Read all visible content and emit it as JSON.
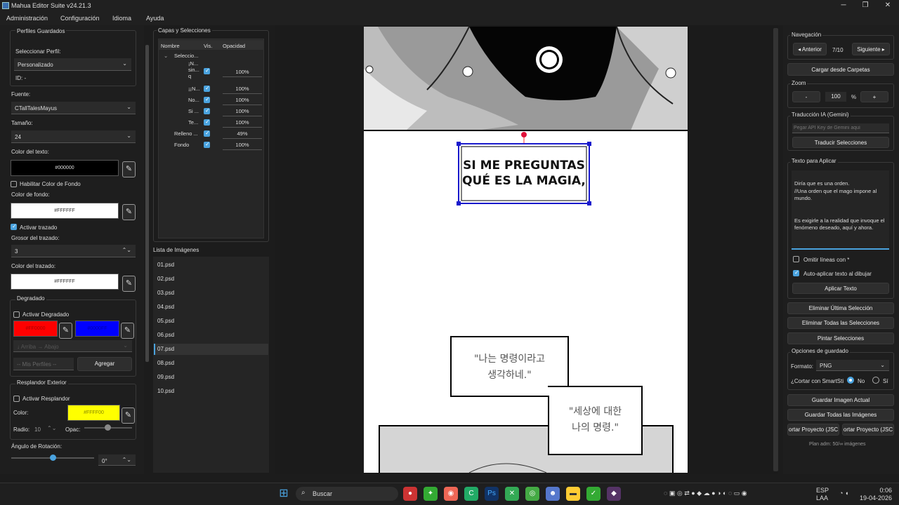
{
  "window": {
    "title": "Mahua Editor Suite v24.21.3",
    "minimize": "─",
    "maximize": "❐",
    "close": "✕"
  },
  "menu": [
    "Administración",
    "Configuración",
    "Idioma",
    "Ayuda"
  ],
  "left": {
    "profiles_group": "Perfiles Guardados",
    "select_profile_label": "Seleccionar Perfil:",
    "select_profile_value": "Personalizado",
    "id_label": "ID: -",
    "font_label": "Fuente:",
    "font_value": "CTallTalesMayus",
    "size_label": "Tamaño:",
    "size_value": "24",
    "text_color_label": "Color del texto:",
    "text_color_value": "#000000",
    "bg_enable_label": "Habilitar Color de Fondo",
    "bg_color_label": "Color de fondo:",
    "bg_color_value": "#FFFFFF",
    "stroke_enable_label": "Activar trazado",
    "stroke_width_label": "Grosor del trazado:",
    "stroke_width_value": "3",
    "stroke_color_label": "Color del trazado:",
    "stroke_color_value": "#FFFFFF",
    "gradient_group": "Degradado",
    "gradient_enable_label": "Activar Degradado",
    "gradient_color1": "#FF0000",
    "gradient_color2": "#0000FF",
    "gradient_direction": "↓ Arriba → Abajo",
    "my_profiles": "-- Mis Perfiles --",
    "add_button": "Agregar",
    "glow_group": "Resplandor Exterior",
    "glow_enable_label": "Activar Resplandor",
    "glow_color_label": "Color:",
    "glow_color_value": "#FFFF00",
    "glow_radius_label": "Radio:",
    "glow_radius_value": "10",
    "glow_opacity_label": "Opac:",
    "rotation_label": "Ángulo de Rotación:",
    "rotation_value": "0°",
    "rotation_level": 0.5
  },
  "layers": {
    "group_title": "Capas y Selecciones",
    "headers": [
      "Nombre",
      "Vis.",
      "Opacidad"
    ],
    "root": "Seleccio...",
    "rows": [
      {
        "name": "¡N... sin... q",
        "visible": true,
        "opacity": "100%"
      },
      {
        "name": "¡¡N...",
        "visible": true,
        "opacity": "100%"
      },
      {
        "name": "No...",
        "visible": true,
        "opacity": "100%"
      },
      {
        "name": "Si ...",
        "visible": true,
        "opacity": "100%"
      },
      {
        "name": "Te...",
        "visible": true,
        "opacity": "100%"
      },
      {
        "name": "Relleno ...",
        "visible": true,
        "opacity": "49%"
      },
      {
        "name": "Fondo",
        "visible": true,
        "opacity": "100%"
      }
    ]
  },
  "images": {
    "title": "Lista de Imágenes",
    "items": [
      "01.psd",
      "02.psd",
      "03.psd",
      "04.psd",
      "05.psd",
      "06.psd",
      "07.psd",
      "08.psd",
      "09.psd",
      "10.psd"
    ],
    "selected": "07.psd"
  },
  "canvas": {
    "bubble_text_line1": "SI ME PREGUNTAS",
    "bubble_text_line2": "QUÉ ES LA MAGIA,",
    "korean_box1_line1": "\"나는 명령이라고",
    "korean_box1_line2": "생각하네.\"",
    "korean_box2_line1": "\"세상에 대한",
    "korean_box2_line2": "나의 명령.\""
  },
  "right": {
    "nav_group": "Navegación",
    "prev_button": "◂ Anterior",
    "page_counter": "7/10",
    "next_button": "Siguiente ▸",
    "load_folders": "Cargar desde Carpetas",
    "zoom_group": "Zoom",
    "zoom_minus": "-",
    "zoom_value": "100",
    "zoom_unit": "%",
    "zoom_plus": "+",
    "ai_group": "Traducción IA (Gemini)",
    "api_placeholder": "Pegar API Key de Gemini aquí",
    "translate_button": "Traducir Selecciones",
    "text_group": "Texto para Aplicar",
    "text_body": "Diría que es una orden.\n//Una orden que el mago impone al mundo.\n\n\nEs exigirle a la realidad que invoque el fenómeno deseado, aquí y ahora.",
    "omit_lines_label": "Omitir líneas con *",
    "auto_apply_label": "Auto-aplicar texto al dibujar",
    "apply_text_button": "Aplicar Texto",
    "delete_last": "Eliminar Última Selección",
    "delete_all": "Eliminar Todas las Selecciones",
    "paint": "Pintar Selecciones",
    "save_group": "Opciones de guardado",
    "format_label": "Formato:",
    "format_value": "PNG",
    "smart_label": "¿Cortar con SmartSti",
    "radio_no": "No",
    "radio_si": "Sí",
    "save_current": "Guardar Imagen Actual",
    "save_all": "Guardar Todas las Imágenes",
    "export_proj": "ortar Proyecto (JSC",
    "import_proj": "ortar Proyecto (JSC",
    "plan": "Plan adm: 50/∞ imágenes"
  },
  "taskbar": {
    "search": "Buscar",
    "lang1": "ESP",
    "lang2": "LAA",
    "time": "0:06",
    "date": "19-04-2026"
  }
}
